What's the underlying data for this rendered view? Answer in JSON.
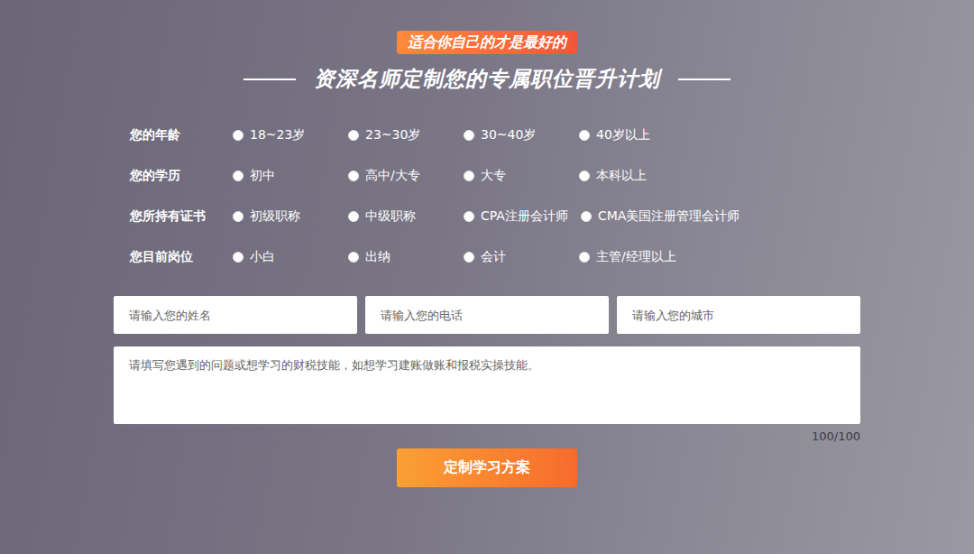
{
  "badge": "适合你自己的才是最好的",
  "heading": "资深名师定制您的专属职位晋升计划",
  "questions": [
    {
      "label": "您的年龄",
      "options": [
        {
          "label": "18~23岁",
          "selected": false
        },
        {
          "label": "23~30岁",
          "selected": false
        },
        {
          "label": "30~40岁",
          "selected": false
        },
        {
          "label": "40岁以上",
          "selected": false
        }
      ]
    },
    {
      "label": "您的学历",
      "options": [
        {
          "label": "初中",
          "selected": false
        },
        {
          "label": "高中/大专",
          "selected": false
        },
        {
          "label": "大专",
          "selected": false
        },
        {
          "label": "本科以上",
          "selected": false
        }
      ]
    },
    {
      "label": "您所持有证书",
      "options": [
        {
          "label": "初级职称",
          "selected": false
        },
        {
          "label": "中级职称",
          "selected": false
        },
        {
          "label": "CPA注册会计师",
          "selected": false
        },
        {
          "label": "CMA美国注册管理会计师",
          "selected": false
        }
      ]
    },
    {
      "label": "您目前岗位",
      "options": [
        {
          "label": "小白",
          "selected": false
        },
        {
          "label": "出纳",
          "selected": false
        },
        {
          "label": "会计",
          "selected": false
        },
        {
          "label": "主管/经理以上",
          "selected": false
        }
      ]
    }
  ],
  "inputs": [
    {
      "placeholder": "请输入您的姓名"
    },
    {
      "placeholder": "请输入您的电话"
    },
    {
      "placeholder": "请输入您的城市"
    }
  ],
  "textarea": {
    "placeholder": "请填写您遇到的问题或想学习的财税技能，如想学习建账做账和报税实操技能。"
  },
  "counter": "100/100",
  "button": "定制学习方案"
}
